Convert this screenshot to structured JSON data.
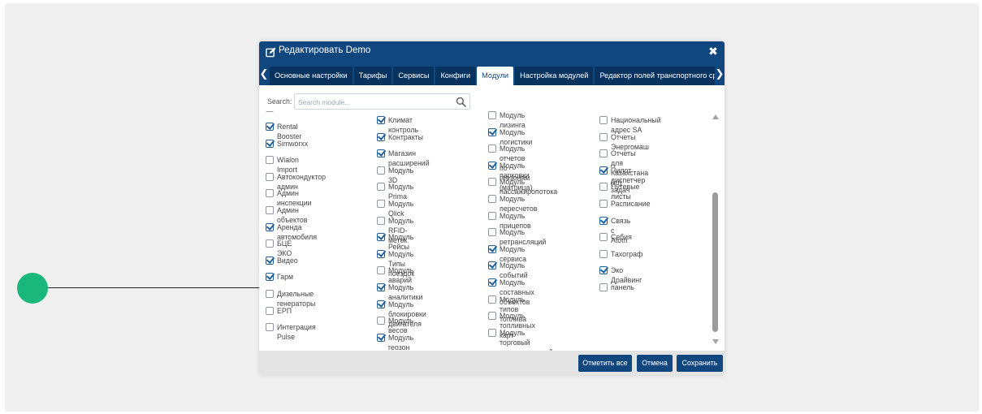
{
  "dialog": {
    "title": "Редактировать Demo",
    "close_symbol": "✖"
  },
  "tabs": [
    {
      "label": "Основные настройки",
      "active": false
    },
    {
      "label": "Тарифы",
      "active": false
    },
    {
      "label": "Сервисы",
      "active": false
    },
    {
      "label": "Конфиги",
      "active": false
    },
    {
      "label": "Модули",
      "active": true
    },
    {
      "label": "Настройка модулей",
      "active": false
    },
    {
      "label": "Редактор полей транспортного сре",
      "active": false
    }
  ],
  "search": {
    "label": "Search:",
    "placeholder": "Search module..."
  },
  "columns": [
    {
      "items": [
        {
          "label": "Rental Booster",
          "checked": true
        },
        {
          "label": "Simworxx",
          "checked": true
        },
        {
          "label": "Wialon Import",
          "checked": false
        },
        {
          "label": "Автокондуктор админ",
          "checked": false
        },
        {
          "label": "Админ инспекции",
          "checked": false
        },
        {
          "label": "Админ объектов",
          "checked": false
        },
        {
          "label": "Аренда автомобиля",
          "checked": true
        },
        {
          "label": "БЦЕ ЭКО",
          "checked": false
        },
        {
          "label": "Видео",
          "checked": true
        },
        {
          "label": "Гарм",
          "checked": true
        },
        {
          "label": "Дизельные генераторы",
          "checked": false
        },
        {
          "label": "ЕРП",
          "checked": false
        },
        {
          "label": "Интеграция Pulse",
          "checked": false
        }
      ]
    },
    {
      "items": [
        {
          "label": "Климат контроль",
          "checked": true
        },
        {
          "label": "Контракты",
          "checked": true
        },
        {
          "label": "Магазин расширений",
          "checked": true
        },
        {
          "label": "Модуль 3D",
          "checked": false
        },
        {
          "label": "Модуль Prima",
          "checked": false
        },
        {
          "label": "Модуль Qlick",
          "checked": false
        },
        {
          "label": "Модуль RFID-меток",
          "checked": false
        },
        {
          "label": "Модуль Рейсы",
          "checked": true
        },
        {
          "label": "Модуль Типы поездок",
          "checked": true
        },
        {
          "label": "Модуль аварий",
          "checked": false
        },
        {
          "label": "Модуль аналитики",
          "checked": true
        },
        {
          "label": "Модуль блокировки двигателя",
          "checked": true
        },
        {
          "label": "Модуль весов",
          "checked": false
        },
        {
          "label": "Модуль геозон",
          "checked": true
        }
      ]
    },
    {
      "items": [
        {
          "label": "Модуль лизинга",
          "checked": false
        },
        {
          "label": "Модуль логистики",
          "checked": true
        },
        {
          "label": "Модуль отчетов по геозонам\n(матрица)",
          "checked": false
        },
        {
          "label": "Модуль парковки",
          "checked": true
        },
        {
          "label": "Модуль пассажиропотока",
          "checked": false
        },
        {
          "label": "Модуль пересчетов",
          "checked": false
        },
        {
          "label": "Модуль прицепов",
          "checked": false
        },
        {
          "label": "Модуль ретрансляций",
          "checked": false
        },
        {
          "label": "Модуль сервиса",
          "checked": true
        },
        {
          "label": "Модуль событий",
          "checked": true
        },
        {
          "label": "Модуль составных объектов",
          "checked": true
        },
        {
          "label": "Модуль типов топлива",
          "checked": false
        },
        {
          "label": "Модуль топливных карт",
          "checked": false
        },
        {
          "label": "Модуль торговый\nпредставителей",
          "checked": false
        }
      ]
    },
    {
      "items": [
        {
          "label": "Национальный адрес SA",
          "checked": false
        },
        {
          "label": "Отчеты Энергомаш",
          "checked": false
        },
        {
          "label": "Отчеты для Казахстана (ru)",
          "checked": false
        },
        {
          "label": "Пилот диспетчер задач",
          "checked": true
        },
        {
          "label": "Путевые листы",
          "checked": false
        },
        {
          "label": "Расписание",
          "checked": false
        },
        {
          "label": "Связь с Atom",
          "checked": true
        },
        {
          "label": "Себия",
          "checked": false
        },
        {
          "label": "Тахограф",
          "checked": false
        },
        {
          "label": "Эко Драйвинг",
          "checked": true
        },
        {
          "label": "панель",
          "checked": false
        }
      ]
    }
  ],
  "footer": {
    "select_all_label": "Отметить все",
    "cancel_label": "Отмена",
    "save_label": "Сохранить"
  },
  "colors": {
    "header_bg": "#11477f",
    "tab_bg": "#09335f",
    "annotation_dot": "#1ab77c"
  }
}
